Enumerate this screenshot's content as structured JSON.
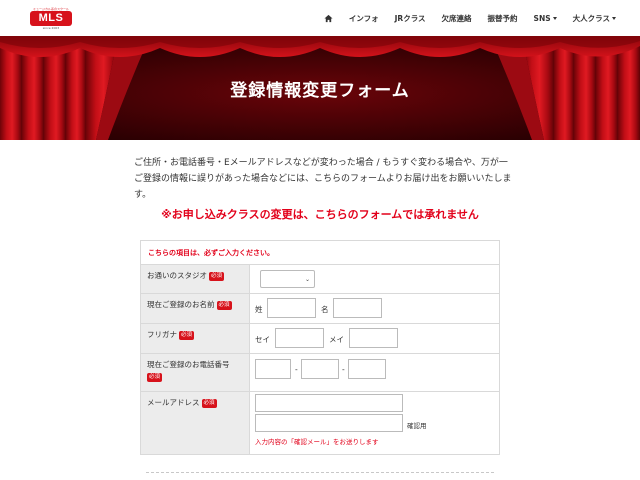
{
  "header": {
    "logo": {
      "text": "MLS",
      "tagline": "ミュージカル系のスクール",
      "sub": "since 2003"
    },
    "nav": [
      {
        "label": "インフォ"
      },
      {
        "label": "JRクラス"
      },
      {
        "label": "欠席連絡"
      },
      {
        "label": "振替予約"
      },
      {
        "label": "SNS"
      },
      {
        "label": "大人クラス"
      }
    ]
  },
  "banner": {
    "title": "登録情報変更フォーム"
  },
  "intro": {
    "text": "ご住所・お電話番号・Eメールアドレスなどが変わった場合 / もうすぐ変わる場合や、万が一ご登録の情報に誤りがあった場合などには、こちらのフォームよりお届け出をお願いいたします。",
    "warning": "※お申し込みクラスの変更は、こちらのフォームでは承れません"
  },
  "form": {
    "note": "こちらの項目は、必ずご入力ください。",
    "required_badge": "必須",
    "studio": {
      "label": "お通いのスタジオ",
      "value": ""
    },
    "name": {
      "label": "現在ご登録のお名前",
      "sei": "姓",
      "mei": "名"
    },
    "furigana": {
      "label": "フリガナ",
      "sei": "セイ",
      "mei": "メイ"
    },
    "phone": {
      "label": "現在ご登録のお電話番号",
      "sep": "-"
    },
    "email": {
      "label": "メールアドレス",
      "confirm": "確認用",
      "error": "入力内容の「確認メール」をお送りします"
    }
  }
}
